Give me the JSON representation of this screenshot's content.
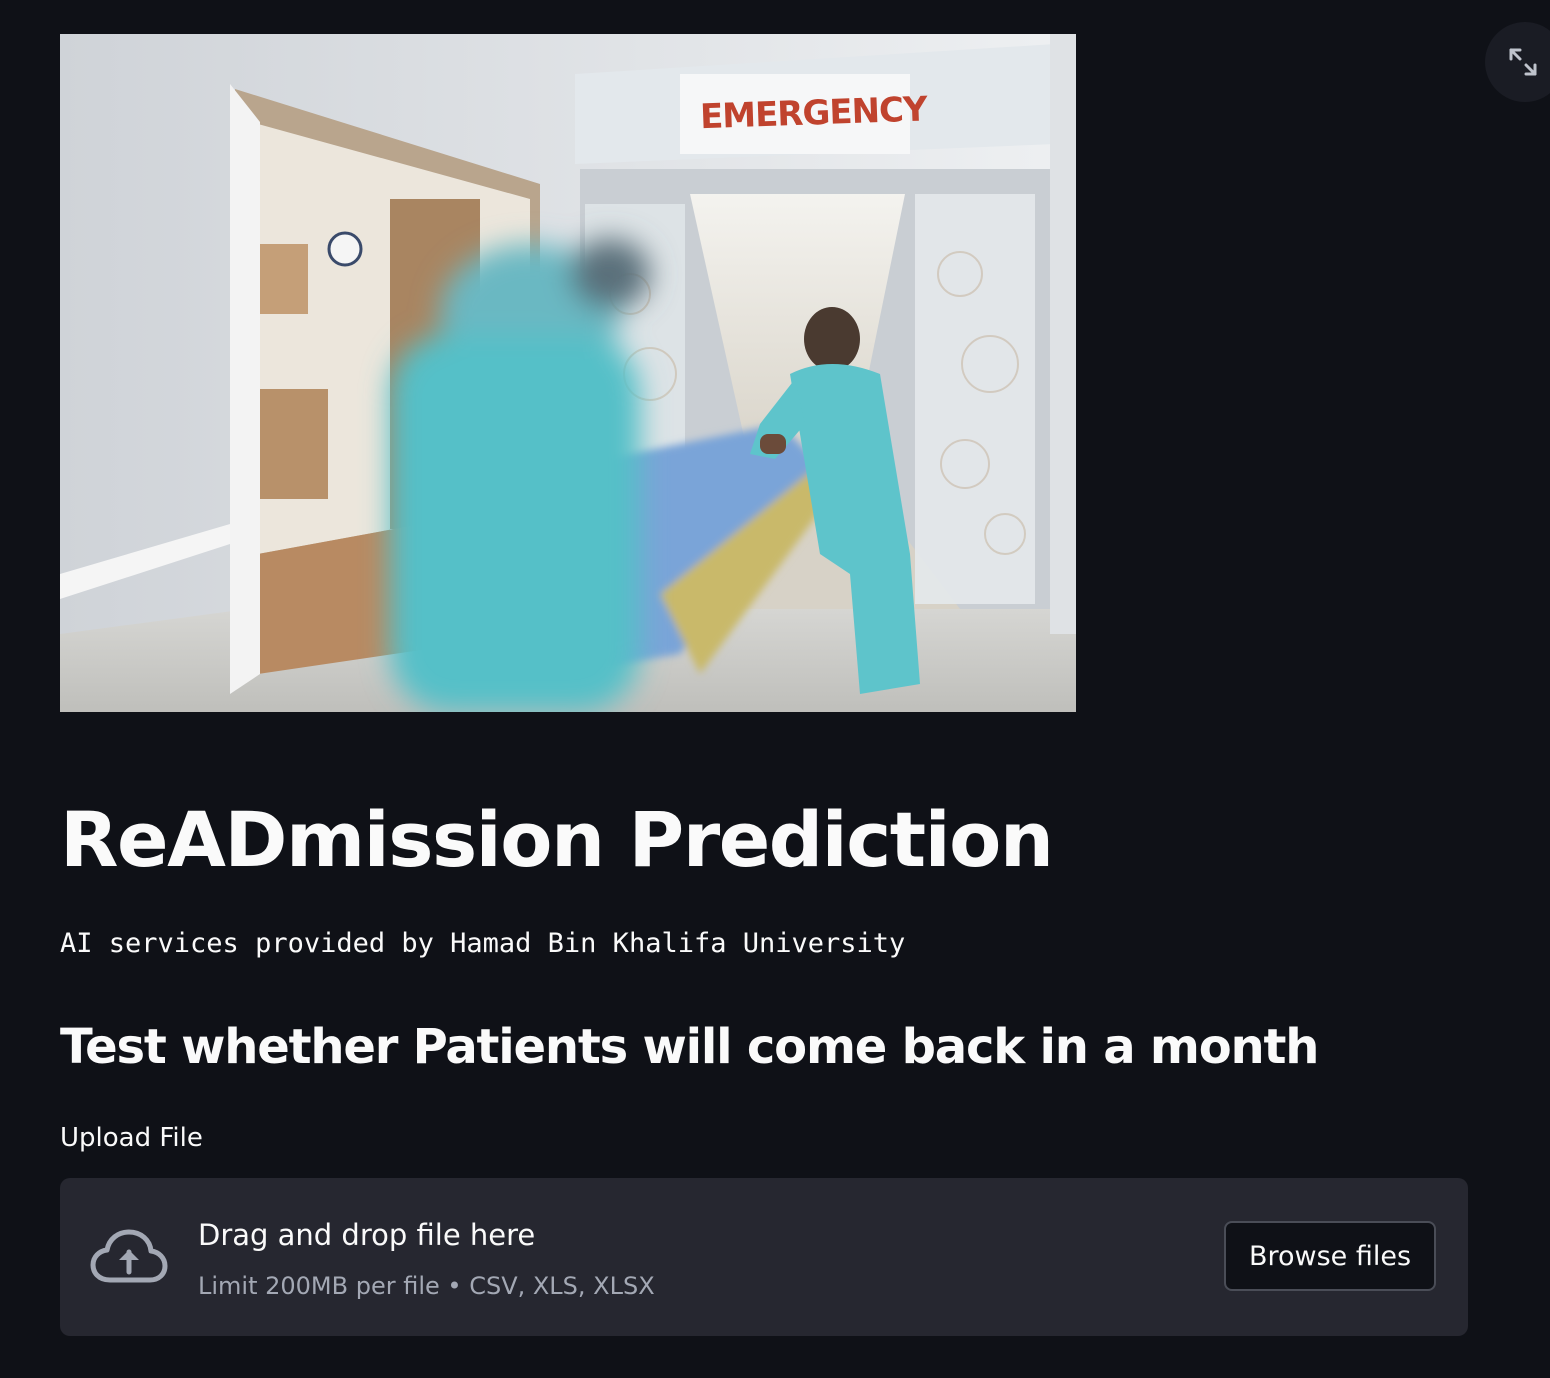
{
  "hero_image": {
    "sign_text": "EMERGENCY"
  },
  "header": {
    "title": "ReADmission Prediction",
    "subtitle": "AI services provided by Hamad Bin Khalifa University"
  },
  "main": {
    "heading": "Test whether Patients will come back in a month",
    "upload": {
      "label": "Upload File",
      "drop_text": "Drag and drop file here",
      "limit_text": "Limit 200MB per file • CSV, XLS, XLSX",
      "browse_label": "Browse files"
    }
  },
  "icons": {
    "fullscreen": "fullscreen-expand-icon",
    "upload": "cloud-upload-icon"
  },
  "colors": {
    "background": "#0f1117",
    "dropzone": "#262730",
    "text": "#fafafa",
    "muted": "#a3a8b4",
    "scrubs": "#5bc3c9",
    "sign": "#c0432e"
  }
}
